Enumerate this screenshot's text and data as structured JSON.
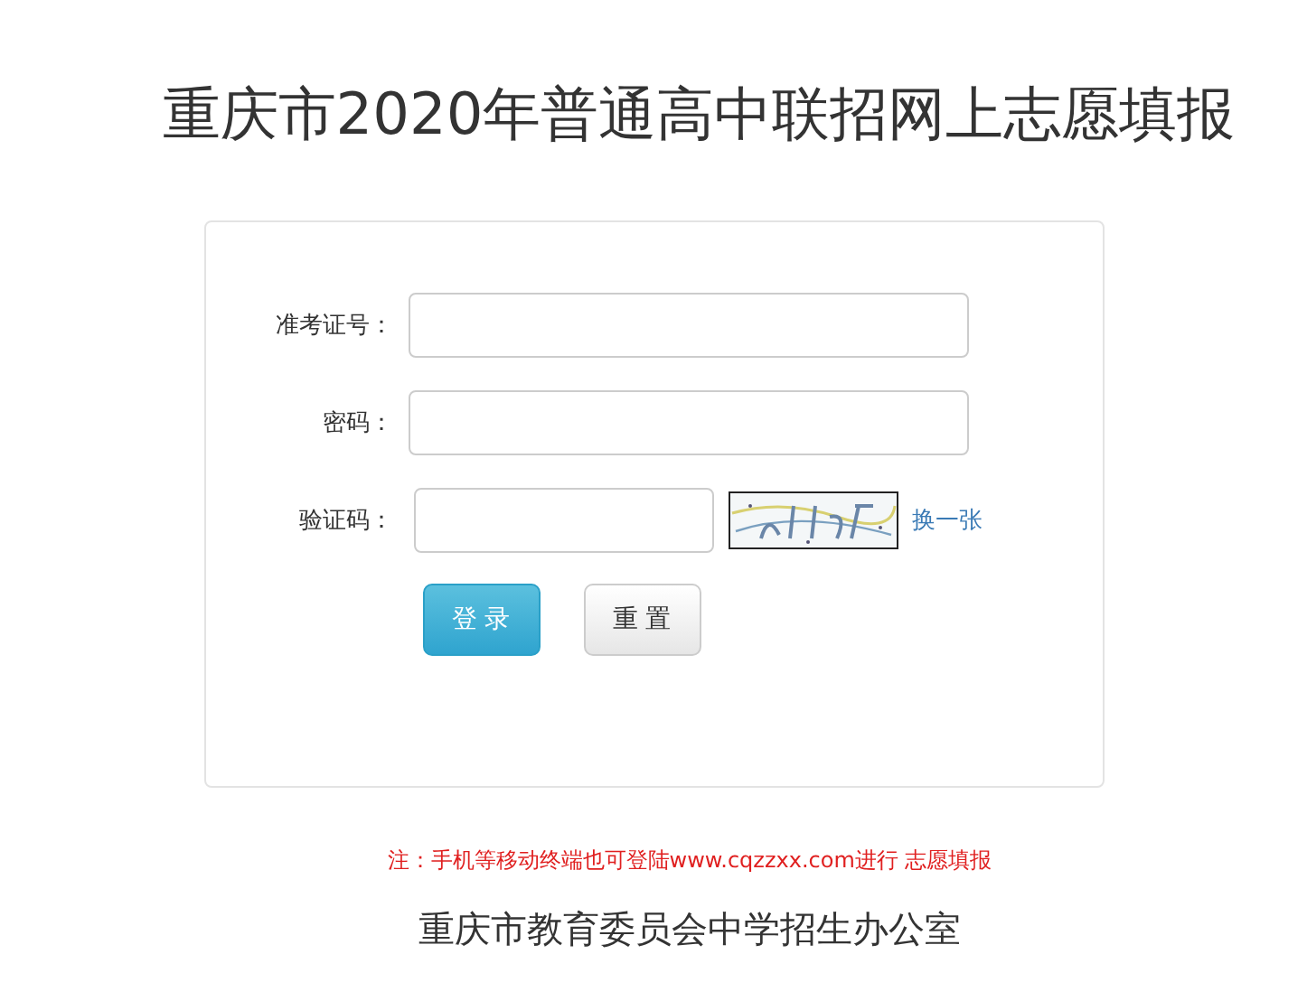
{
  "title": "重庆市2020年普通高中联招网上志愿填报",
  "form": {
    "fields": [
      {
        "label": "准考证号：",
        "kind": "text"
      },
      {
        "label": "密码：",
        "kind": "password"
      },
      {
        "label": "验证码：",
        "kind": "captcha",
        "refresh_link": "换一张"
      }
    ],
    "buttons": [
      {
        "label": "登 录",
        "kind": "primary"
      },
      {
        "label": "重 置",
        "kind": "default"
      }
    ]
  },
  "notice": "注：手机等移动终端也可登陆www.cqzzxx.com进行 志愿填报",
  "footer": "重庆市教育委员会中学招生办公室"
}
